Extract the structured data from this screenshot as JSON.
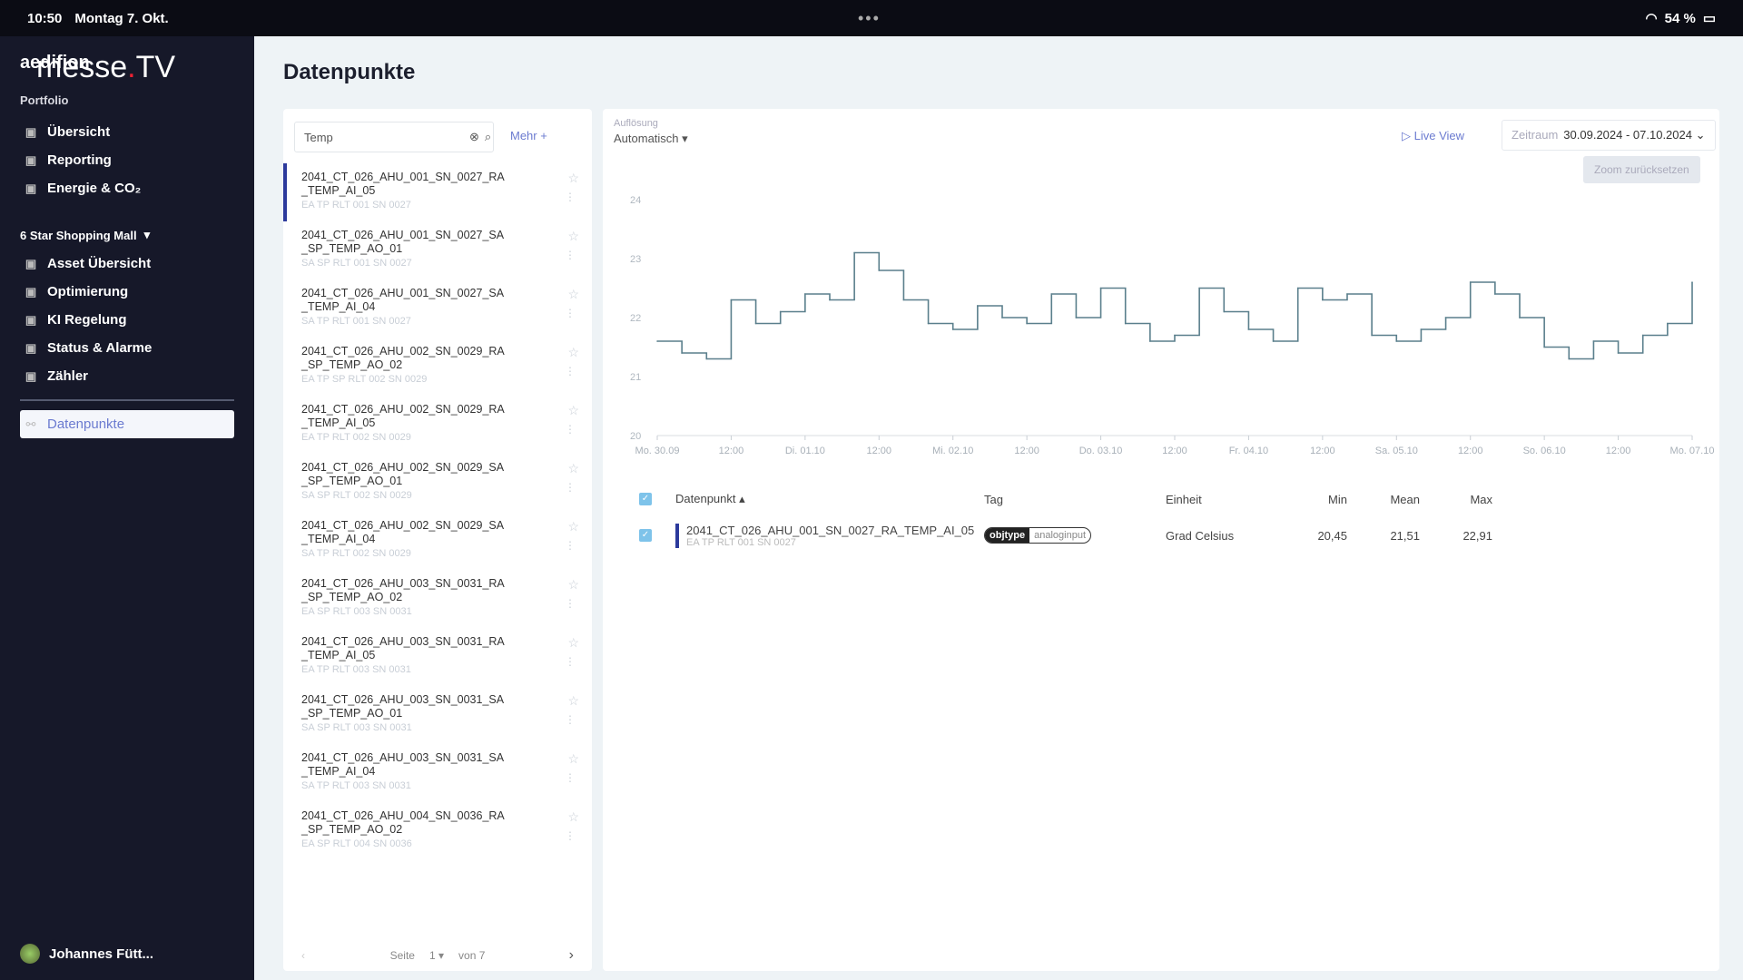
{
  "status_bar": {
    "time": "10:50",
    "date": "Montag 7. Okt.",
    "battery": "54 %"
  },
  "watermark": {
    "text": "messe.TV"
  },
  "sidebar": {
    "brand": "aedifion",
    "section": "Portfolio",
    "portfolio_items": [
      {
        "label": "Übersicht",
        "icon": "building-icon"
      },
      {
        "label": "Reporting",
        "icon": "document-icon"
      },
      {
        "label": "Energie & CO₂",
        "icon": "chart-icon"
      }
    ],
    "project": "6 Star Shopping Mall",
    "project_items": [
      {
        "label": "Asset Übersicht",
        "icon": "asset-icon"
      },
      {
        "label": "Optimierung",
        "icon": "rocket-icon"
      },
      {
        "label": "KI Regelung",
        "icon": "tools-icon"
      },
      {
        "label": "Status & Alarme",
        "icon": "bell-icon"
      },
      {
        "label": "Zähler",
        "icon": "meter-icon"
      }
    ],
    "active_item": "Datenpunkte",
    "user": "Johannes Fütt..."
  },
  "main": {
    "title": "Datenpunkte",
    "search": {
      "value": "Temp"
    },
    "mehr": "Mehr +",
    "items": [
      {
        "name": "2041_CT_026_AHU_001_SN_0027_RA_TEMP_AI_05",
        "sub": "EA TP RLT 001 SN 0027"
      },
      {
        "name": "2041_CT_026_AHU_001_SN_0027_SA_SP_TEMP_AO_01",
        "sub": "SA SP RLT 001 SN 0027"
      },
      {
        "name": "2041_CT_026_AHU_001_SN_0027_SA_TEMP_AI_04",
        "sub": "SA TP RLT 001 SN 0027"
      },
      {
        "name": "2041_CT_026_AHU_002_SN_0029_RA_SP_TEMP_AO_02",
        "sub": "EA TP SP RLT 002 SN 0029"
      },
      {
        "name": "2041_CT_026_AHU_002_SN_0029_RA_TEMP_AI_05",
        "sub": "EA TP RLT 002 SN 0029"
      },
      {
        "name": "2041_CT_026_AHU_002_SN_0029_SA_SP_TEMP_AO_01",
        "sub": "SA SP RLT 002 SN 0029"
      },
      {
        "name": "2041_CT_026_AHU_002_SN_0029_SA_TEMP_AI_04",
        "sub": "SA TP RLT 002 SN 0029"
      },
      {
        "name": "2041_CT_026_AHU_003_SN_0031_RA_SP_TEMP_AO_02",
        "sub": "EA SP RLT 003 SN 0031"
      },
      {
        "name": "2041_CT_026_AHU_003_SN_0031_RA_TEMP_AI_05",
        "sub": "EA TP RLT 003 SN 0031"
      },
      {
        "name": "2041_CT_026_AHU_003_SN_0031_SA_SP_TEMP_AO_01",
        "sub": "SA SP RLT 003 SN 0031"
      },
      {
        "name": "2041_CT_026_AHU_003_SN_0031_SA_TEMP_AI_04",
        "sub": "SA TP RLT 003 SN 0031"
      },
      {
        "name": "2041_CT_026_AHU_004_SN_0036_RA_SP_TEMP_AO_02",
        "sub": "EA SP RLT 004 SN 0036"
      }
    ],
    "pager": {
      "label": "Seite",
      "page": "1",
      "of": "von 7"
    },
    "chart_controls": {
      "resolution_label": "Auflösung",
      "resolution": "Automatisch",
      "live_view": "Live View",
      "zeitraum_label": "Zeitraum",
      "zeitraum": "30.09.2024 - 07.10.2024",
      "zoom_reset": "Zoom zurücksetzen"
    },
    "table": {
      "headers": {
        "datapoint": "Datenpunkt",
        "tag": "Tag",
        "unit": "Einheit",
        "min": "Min",
        "mean": "Mean",
        "max": "Max"
      },
      "rows": [
        {
          "name": "2041_CT_026_AHU_001_SN_0027_RA_TEMP_AI_05",
          "sub": "EA TP RLT 001 SN 0027",
          "tag_key": "objtype",
          "tag_value": "analoginput",
          "unit": "Grad Celsius",
          "min": "20,45",
          "mean": "21,51",
          "max": "22,91"
        }
      ]
    }
  },
  "chart_data": {
    "type": "line",
    "step": true,
    "color": "#5a7f8c",
    "ylim": [
      20,
      24
    ],
    "yticks": [
      20,
      21,
      22,
      23,
      24
    ],
    "xticks": [
      "Mo. 30.09",
      "12:00",
      "Di. 01.10",
      "12:00",
      "Mi. 02.10",
      "12:00",
      "Do. 03.10",
      "12:00",
      "Fr. 04.10",
      "12:00",
      "Sa. 05.10",
      "12:00",
      "So. 06.10",
      "12:00",
      "Mo. 07.10"
    ],
    "x": [
      "2024-09-30T00:00",
      "2024-09-30T04:00",
      "2024-09-30T08:00",
      "2024-09-30T12:00",
      "2024-09-30T16:00",
      "2024-09-30T20:00",
      "2024-10-01T00:00",
      "2024-10-01T04:00",
      "2024-10-01T08:00",
      "2024-10-01T12:00",
      "2024-10-01T16:00",
      "2024-10-01T20:00",
      "2024-10-02T00:00",
      "2024-10-02T04:00",
      "2024-10-02T08:00",
      "2024-10-02T12:00",
      "2024-10-02T16:00",
      "2024-10-02T20:00",
      "2024-10-03T00:00",
      "2024-10-03T04:00",
      "2024-10-03T08:00",
      "2024-10-03T12:00",
      "2024-10-03T16:00",
      "2024-10-03T20:00",
      "2024-10-04T00:00",
      "2024-10-04T04:00",
      "2024-10-04T08:00",
      "2024-10-04T12:00",
      "2024-10-04T16:00",
      "2024-10-04T20:00",
      "2024-10-05T00:00",
      "2024-10-05T04:00",
      "2024-10-05T08:00",
      "2024-10-05T12:00",
      "2024-10-05T16:00",
      "2024-10-05T20:00",
      "2024-10-06T00:00",
      "2024-10-06T04:00",
      "2024-10-06T08:00",
      "2024-10-06T12:00",
      "2024-10-06T16:00",
      "2024-10-06T20:00",
      "2024-10-07T00:00"
    ],
    "values": [
      21.6,
      21.4,
      21.3,
      22.3,
      21.9,
      22.1,
      22.4,
      22.3,
      23.1,
      22.8,
      22.3,
      21.9,
      21.8,
      22.2,
      22.0,
      21.9,
      22.4,
      22.0,
      22.5,
      21.9,
      21.6,
      21.7,
      22.5,
      22.1,
      21.8,
      21.6,
      22.5,
      22.3,
      22.4,
      21.7,
      21.6,
      21.8,
      22.0,
      22.6,
      22.4,
      22.0,
      21.5,
      21.3,
      21.6,
      21.4,
      21.7,
      21.9,
      22.6
    ]
  }
}
